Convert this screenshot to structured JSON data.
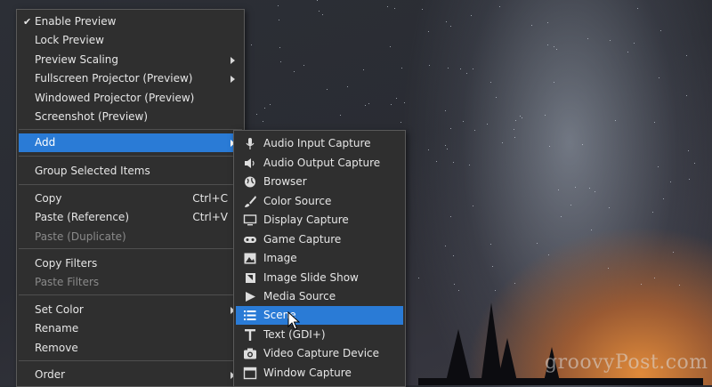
{
  "main_menu": {
    "items": [
      {
        "label": "Enable Preview",
        "checked": true
      },
      {
        "label": "Lock Preview"
      },
      {
        "label": "Preview Scaling",
        "submenu": true
      },
      {
        "label": "Fullscreen Projector (Preview)",
        "submenu": true
      },
      {
        "label": "Windowed Projector (Preview)"
      },
      {
        "label": "Screenshot (Preview)"
      },
      {
        "label": "Add",
        "submenu": true,
        "highlighted": true
      },
      {
        "label": "Group Selected Items"
      },
      {
        "label": "Copy",
        "shortcut": "Ctrl+C"
      },
      {
        "label": "Paste (Reference)",
        "shortcut": "Ctrl+V"
      },
      {
        "label": "Paste (Duplicate)",
        "disabled": true
      },
      {
        "label": "Copy Filters"
      },
      {
        "label": "Paste Filters",
        "disabled": true
      },
      {
        "label": "Set Color",
        "submenu": true
      },
      {
        "label": "Rename"
      },
      {
        "label": "Remove"
      },
      {
        "label": "Order",
        "submenu": true
      }
    ],
    "check_glyph": "✔"
  },
  "add_submenu": {
    "items": [
      {
        "label": "Audio Input Capture",
        "icon": "microphone-icon"
      },
      {
        "label": "Audio Output Capture",
        "icon": "speaker-icon"
      },
      {
        "label": "Browser",
        "icon": "globe-icon"
      },
      {
        "label": "Color Source",
        "icon": "paintbrush-icon"
      },
      {
        "label": "Display Capture",
        "icon": "monitor-icon"
      },
      {
        "label": "Game Capture",
        "icon": "gamepad-icon"
      },
      {
        "label": "Image",
        "icon": "image-icon"
      },
      {
        "label": "Image Slide Show",
        "icon": "slideshow-icon"
      },
      {
        "label": "Media Source",
        "icon": "play-icon"
      },
      {
        "label": "Scene",
        "icon": "list-icon",
        "highlighted": true
      },
      {
        "label": "Text (GDI+)",
        "icon": "text-icon"
      },
      {
        "label": "Video Capture Device",
        "icon": "camera-icon"
      },
      {
        "label": "Window Capture",
        "icon": "window-icon"
      }
    ]
  },
  "watermark": "groovyPost.com",
  "colors": {
    "menu_bg": "#2f2f2f",
    "highlight": "#2a7bd6",
    "disabled_text": "#8a8a8a"
  }
}
